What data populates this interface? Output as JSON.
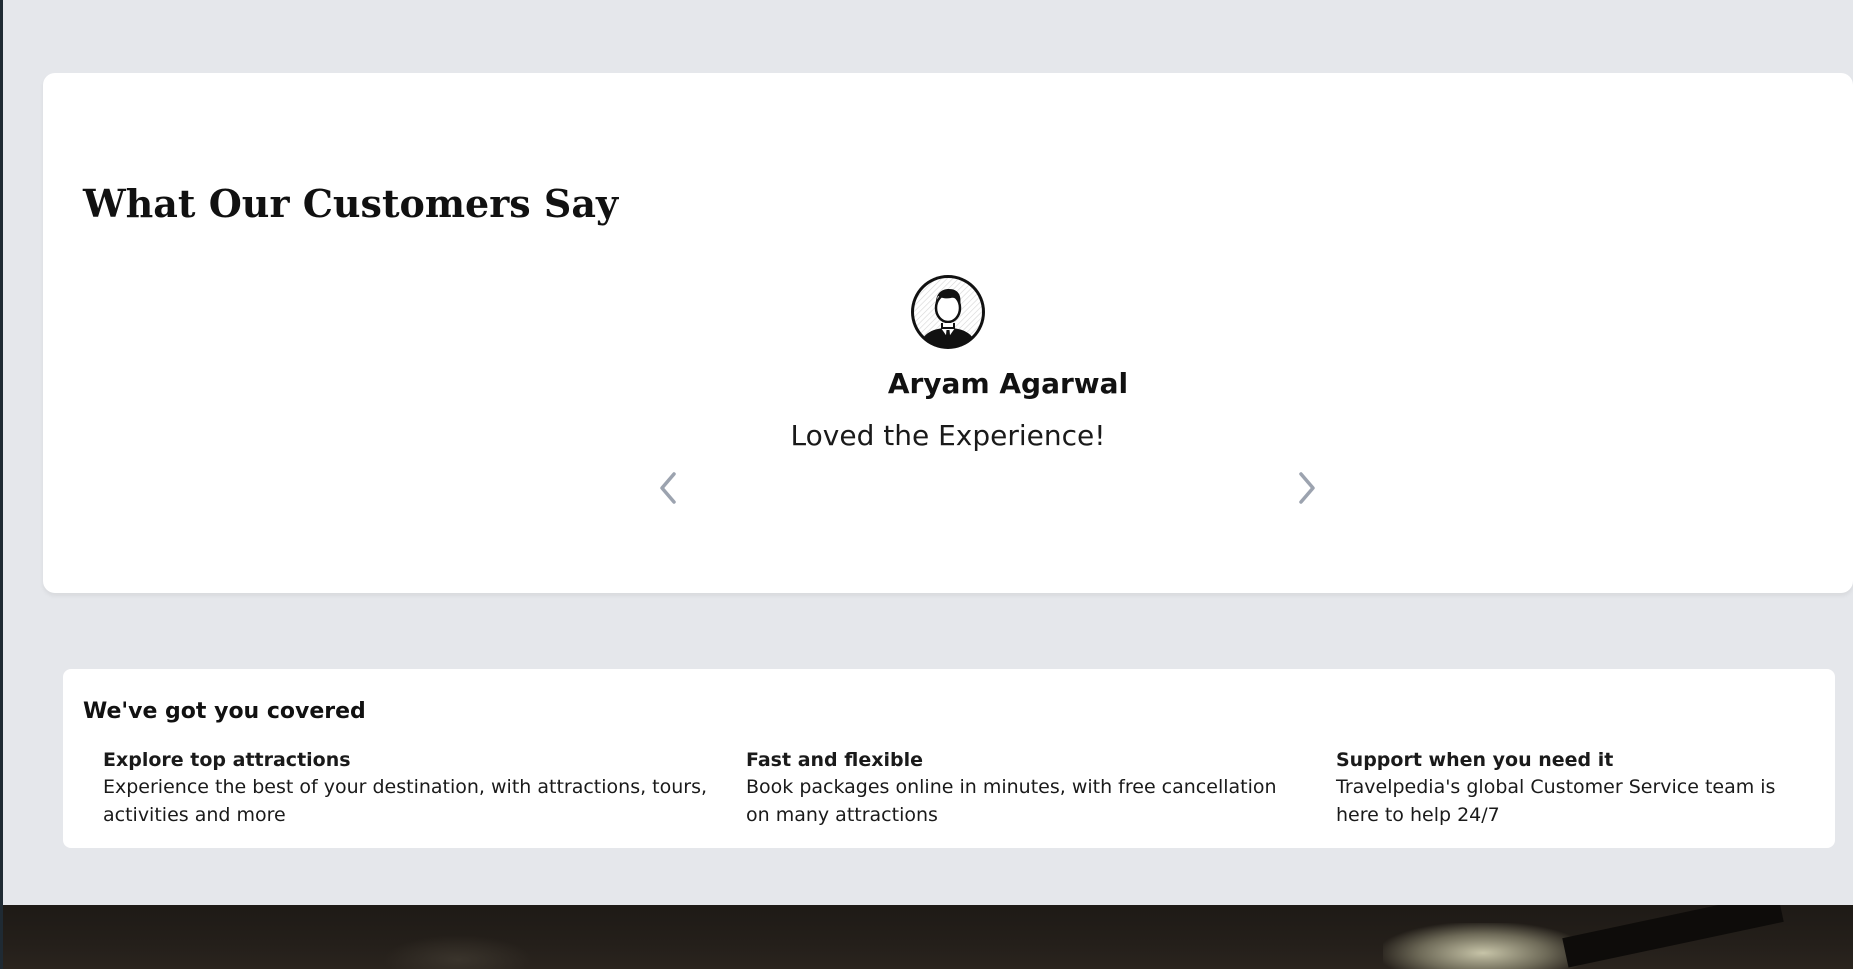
{
  "testimonials": {
    "title": "What Our Customers Say",
    "avatar_icon": "user-avatar-icon",
    "reviewer_name": "Aryam Agarwal",
    "review_text": "Loved the Experience!",
    "prev_icon": "chevron-left-icon",
    "next_icon": "chevron-right-icon",
    "arrow_color": "#9ca3af"
  },
  "covered": {
    "title": "We've got you covered",
    "features": [
      {
        "title": "Explore top attractions",
        "description": "Experience the best of your destination, with attractions, tours, activities and more"
      },
      {
        "title": "Fast and flexible",
        "description": "Book packages online in minutes, with free cancellation on many attractions"
      },
      {
        "title": "Support when you need it",
        "description": "Travelpedia's global Customer Service team is here to help 24/7"
      }
    ]
  },
  "colors": {
    "page_background": "#e5e7eb",
    "card_background": "#ffffff",
    "text": "#111111"
  }
}
